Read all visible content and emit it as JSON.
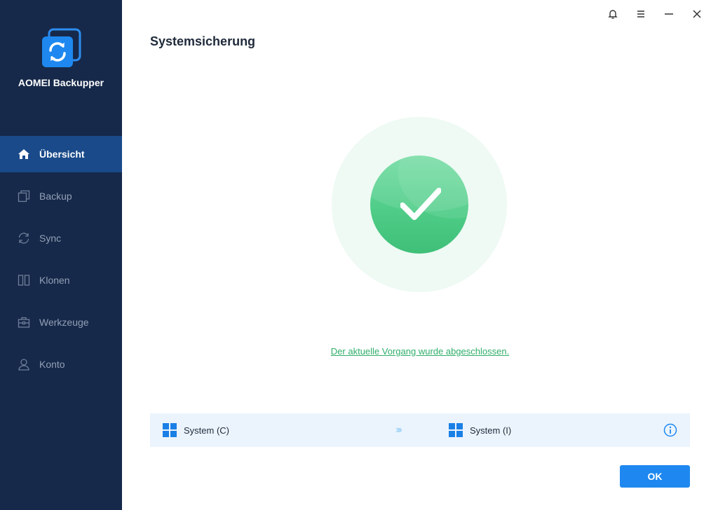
{
  "app": {
    "name": "AOMEI Backupper"
  },
  "sidebar": {
    "items": [
      {
        "label": "Übersicht",
        "icon": "home-icon",
        "active": true
      },
      {
        "label": "Backup",
        "icon": "backup-icon",
        "active": false
      },
      {
        "label": "Sync",
        "icon": "sync-icon",
        "active": false
      },
      {
        "label": "Klonen",
        "icon": "clone-icon",
        "active": false
      },
      {
        "label": "Werkzeuge",
        "icon": "toolbox-icon",
        "active": false
      },
      {
        "label": "Konto",
        "icon": "user-icon",
        "active": false
      }
    ]
  },
  "page": {
    "title": "Systemsicherung",
    "status_message": "Der aktuelle Vorgang wurde abgeschlossen."
  },
  "route": {
    "source": {
      "label": "System (C)",
      "icon": "windows-icon"
    },
    "destination": {
      "label": "System (I)",
      "icon": "windows-icon"
    }
  },
  "actions": {
    "ok_label": "OK"
  },
  "colors": {
    "sidebar_bg": "#16294a",
    "active_item": "#1a4a8a",
    "accent": "#1e88f0",
    "success": "#4fcd88",
    "link": "#2fae6a"
  }
}
